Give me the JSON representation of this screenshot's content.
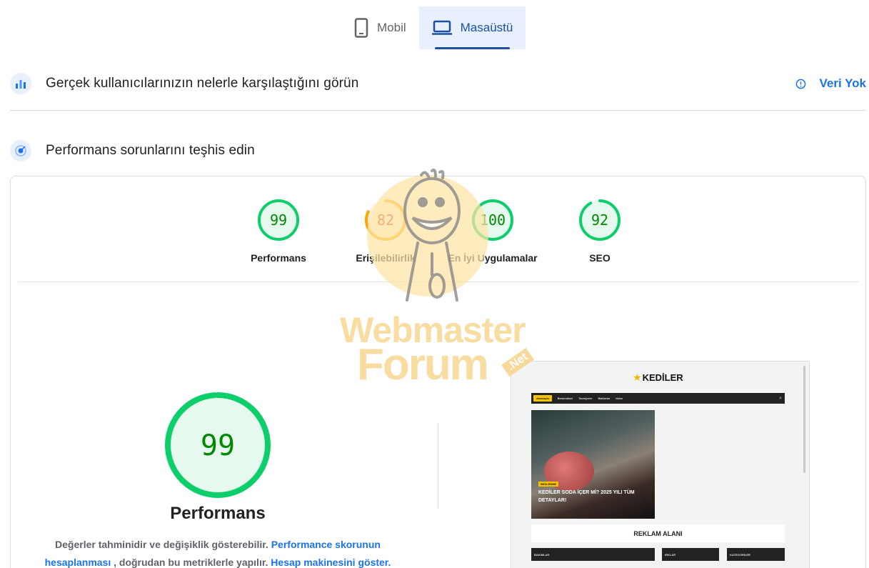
{
  "device_tabs": [
    {
      "label": "Mobil",
      "icon": "phone-icon",
      "active": false
    },
    {
      "label": "Masaüstü",
      "icon": "laptop-icon",
      "active": true
    }
  ],
  "real_users": {
    "title": "Gerçek kullanıcılarınızın nelerle karşılaştığını görün",
    "status": "Veri Yok",
    "icon": "crux-chart-icon"
  },
  "diagnose": {
    "title": "Performans sorunlarını teşhis edin",
    "icon": "lighthouse-icon"
  },
  "scores": [
    {
      "label": "Performans",
      "value": 99,
      "color": "#0cce6b",
      "bg": "#e6f9ee",
      "text": "#008800"
    },
    {
      "label": "Erişilebilirlik",
      "value": 82,
      "color": "#ffa400",
      "bg": "#fff3e0",
      "text": "#c33300"
    },
    {
      "label": "En İyi Uygulamalar",
      "value": 100,
      "color": "#0cce6b",
      "bg": "#e6f9ee",
      "text": "#008800"
    },
    {
      "label": "SEO",
      "value": 92,
      "color": "#0cce6b",
      "bg": "#e6f9ee",
      "text": "#008800"
    }
  ],
  "main_score": {
    "value": 99,
    "label": "Performans",
    "color": "#0cce6b",
    "bg": "#e6f9ee",
    "text": "#008800"
  },
  "description": {
    "text1": "Değerler tahminidir ve değişiklik gösterebilir.",
    "link1": "Performance skorunun hesaplanması",
    "text2": ", doğrudan bu metriklerle yapılır.",
    "link2": "Hesap makinesini göster."
  },
  "preview": {
    "logo": "KEDİLER",
    "nav": [
      "Anasayfa",
      "Beslenklari",
      "Tavsiyeler",
      "Bakimlar",
      "Irklar"
    ],
    "article_tag": "BESLENME",
    "article_title": "KEDİLER SODA İÇER Mİ? 2025 YILI TÜM DETAYLAR!",
    "ad": "REKLAM ALANI",
    "footer_blocks": [
      "BAKIMLAR",
      "IRKLAR",
      "KATEGORİLER"
    ]
  },
  "watermark": {
    "line1": "Webmaster",
    "line2": "Forum",
    "tag": ".Net"
  }
}
